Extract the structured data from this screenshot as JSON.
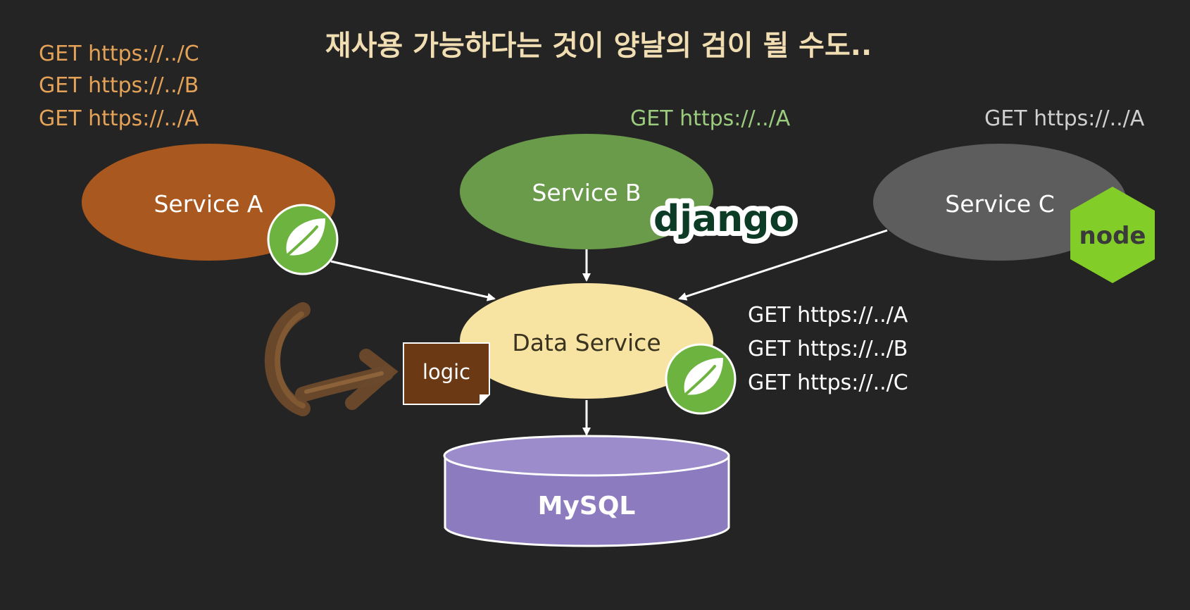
{
  "title": "재사용 가능하다는 것이 양날의 검이 될 수도..",
  "colors": {
    "background": "#252424",
    "title": "#f1ddb2",
    "orange_text": "#e3a257",
    "green_text": "#9bcc7e",
    "gray_text": "#cfcfcf",
    "service_a": "#a9591f",
    "service_b": "#6a9b4b",
    "service_c": "#5e5d5e",
    "data_service": "#f7e3a2",
    "mysql": "#8c7bbf",
    "spring": "#6db33f",
    "node": "#83cd29",
    "logic_box": "#6b3a14"
  },
  "service_a": {
    "label": "Service A",
    "requests": [
      "GET https://../C",
      "GET https://../B",
      "GET https://../A"
    ],
    "badge_icon": "spring-leaf-icon"
  },
  "service_b": {
    "label": "Service B",
    "request": "GET https://../A",
    "badge": "django"
  },
  "service_c": {
    "label": "Service C",
    "request": "GET https://../A",
    "badge": "node"
  },
  "data_service": {
    "label": "Data Service",
    "endpoints": [
      "GET https://../A",
      "GET https://../B",
      "GET https://../C"
    ],
    "badge_icon": "spring-leaf-icon"
  },
  "logic_note": "logic",
  "database": "MySQL"
}
